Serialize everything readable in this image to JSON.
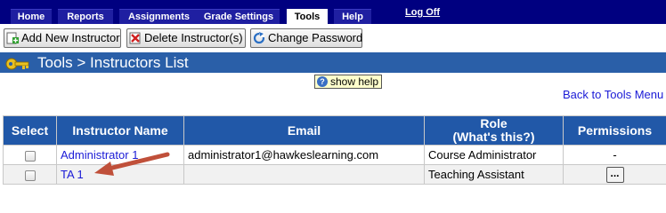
{
  "nav": {
    "tabs": [
      "Home",
      "Reports",
      "Assignments",
      "Grade Settings",
      "Tools",
      "Help"
    ],
    "active_tab": "Tools",
    "logoff": "Log Off"
  },
  "toolbar": {
    "add": "Add New Instructor",
    "delete": "Delete Instructor(s)",
    "change_password": "Change Password"
  },
  "page_title": "Tools > Instructors List",
  "help_label": "show help",
  "back_link": "Back to Tools Menu",
  "table": {
    "headers": [
      "Select",
      "Instructor Name",
      "Email",
      "Role\n(What's this?)",
      "Permissions"
    ],
    "role_header_line1": "Role",
    "role_header_line2": "(What's this?)",
    "rows": [
      {
        "name": "Administrator 1",
        "email": "administrator1@hawkeslearning.com",
        "role": "Course Administrator",
        "permissions": "-"
      },
      {
        "name": "TA 1",
        "email": "",
        "role": "Teaching Assistant",
        "permissions": "..."
      }
    ]
  },
  "colors": {
    "nav_bg": "#000080",
    "title_bg": "#2a5fa8",
    "header_bg": "#2158a8",
    "link": "#1a1ad6",
    "arrow": "#c0503a"
  }
}
